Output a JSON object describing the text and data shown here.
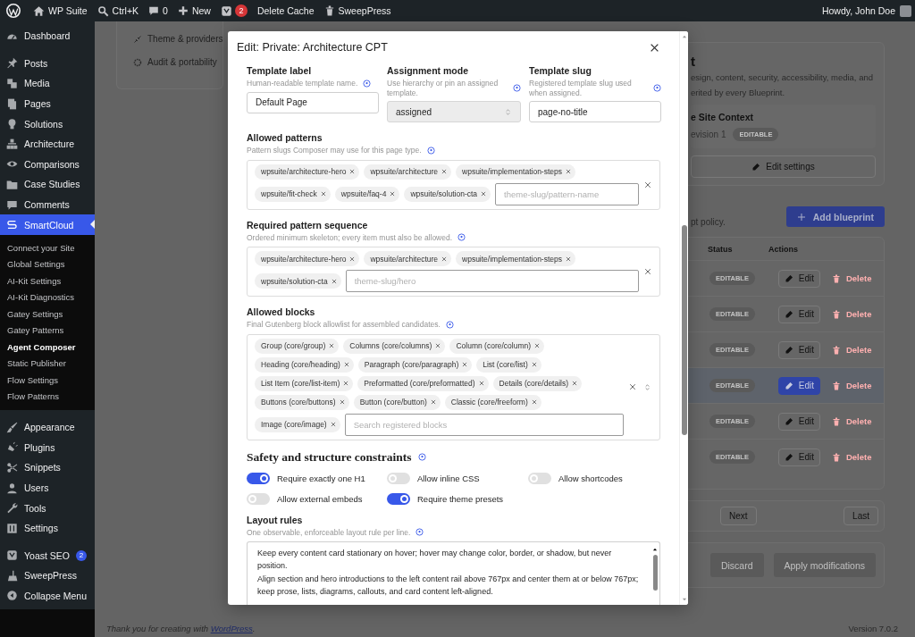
{
  "admin_bar": {
    "items": [
      {
        "kind": "logo"
      },
      {
        "kind": "site",
        "label": "WP Suite"
      },
      {
        "kind": "search",
        "label": "Ctrl+K"
      },
      {
        "kind": "comments",
        "label": "0"
      },
      {
        "kind": "new",
        "label": "New"
      },
      {
        "kind": "seo",
        "badge": "2"
      },
      {
        "kind": "text",
        "label": "Delete Cache"
      },
      {
        "kind": "sweep",
        "label": "SweepPress"
      }
    ],
    "greeting": "Howdy, John Doe"
  },
  "sidebar": {
    "groups": [
      [
        {
          "label": "Dashboard",
          "selected": false
        }
      ],
      [
        {
          "label": "Posts",
          "selected": false
        },
        {
          "label": "Media",
          "selected": false
        },
        {
          "label": "Pages",
          "selected": false
        },
        {
          "label": "Solutions",
          "selected": false
        },
        {
          "label": "Architecture",
          "selected": false
        },
        {
          "label": "Comparisons",
          "selected": false
        },
        {
          "label": "Case Studies",
          "selected": false
        },
        {
          "label": "Comments",
          "selected": false
        },
        {
          "label": "SmartCloud",
          "selected": true,
          "children": [
            {
              "label": "Connect your Site",
              "selected": false
            },
            {
              "label": "Global Settings",
              "selected": false
            },
            {
              "label": "AI-Kit Settings",
              "selected": false
            },
            {
              "label": "AI-Kit Diagnostics",
              "selected": false
            },
            {
              "label": "Gatey Settings",
              "selected": false
            },
            {
              "label": "Gatey Patterns",
              "selected": false
            },
            {
              "label": "Agent Composer",
              "selected": true
            },
            {
              "label": "Static Publisher",
              "selected": false
            },
            {
              "label": "Flow Settings",
              "selected": false
            },
            {
              "label": "Flow Patterns",
              "selected": false
            }
          ]
        }
      ],
      [
        {
          "label": "Appearance",
          "selected": false
        },
        {
          "label": "Plugins",
          "selected": false
        },
        {
          "label": "Snippets",
          "selected": false
        },
        {
          "label": "Users",
          "selected": false
        },
        {
          "label": "Tools",
          "selected": false
        },
        {
          "label": "Settings",
          "selected": false
        }
      ],
      [
        {
          "label": "Yoast SEO",
          "selected": false,
          "badge": "2"
        },
        {
          "label": "SweepPress",
          "selected": false
        },
        {
          "label": "Collapse Menu",
          "selected": false
        }
      ]
    ]
  },
  "background": {
    "side_nav": [
      {
        "label": "Theme & providers"
      },
      {
        "label": "Audit & portability"
      }
    ],
    "settings_card": {
      "title": "t",
      "description_lines": [
        "esign, content, security, accessibility, media, and",
        "erited by every Blueprint."
      ],
      "context": {
        "title": "e Site Context",
        "revision": "evision 1",
        "badge": "EDITABLE"
      },
      "button": "Edit settings"
    },
    "policy_note": "pt policy.",
    "add_button": "Add blueprint",
    "table": {
      "columns": [
        "Status",
        "Actions"
      ],
      "rows": [
        {
          "status": "EDITABLE",
          "edit": "Edit",
          "delete": "Delete",
          "selected": false
        },
        {
          "status": "EDITABLE",
          "edit": "Edit",
          "delete": "Delete",
          "selected": false
        },
        {
          "status": "EDITABLE",
          "edit": "Edit",
          "delete": "Delete",
          "selected": false
        },
        {
          "status": "EDITABLE",
          "edit": "Edit",
          "delete": "Delete",
          "selected": true
        },
        {
          "status": "EDITABLE",
          "edit": "Edit",
          "delete": "Delete",
          "selected": false
        },
        {
          "status": "EDITABLE",
          "edit": "Edit",
          "delete": "Delete",
          "selected": false
        }
      ]
    },
    "pagination": {
      "next": "Next",
      "last": "Last"
    },
    "actions": {
      "discard": "Discard",
      "apply": "Apply modifications",
      "disabled": true
    }
  },
  "modal": {
    "title": "Edit: Private: Architecture CPT",
    "fields": [
      {
        "kind": "text",
        "label": "Template label",
        "hint": "Human-readable template name.",
        "value": "Default Page"
      },
      {
        "kind": "select",
        "label": "Assignment mode",
        "hint": "Use hierarchy or pin an assigned template.",
        "value": "assigned",
        "disabled": true
      },
      {
        "kind": "text",
        "label": "Template slug",
        "hint": "Registered template slug used when assigned.",
        "value": "page-no-title"
      }
    ],
    "tag_fields": [
      {
        "label": "Allowed patterns",
        "hint": "Pattern slugs Composer may use for this page type.",
        "tags": [
          "wpsuite/architecture-hero",
          "wpsuite/architecture",
          "wpsuite/implementation-steps",
          "wpsuite/fit-check",
          "wpsuite/faq-4",
          "wpsuite/solution-cta"
        ],
        "placeholder": "theme-slug/pattern-name",
        "dropdown": false
      },
      {
        "label": "Required pattern sequence",
        "hint": "Ordered minimum skeleton; every item must also be allowed.",
        "tags": [
          "wpsuite/architecture-hero",
          "wpsuite/architecture",
          "wpsuite/implementation-steps",
          "wpsuite/solution-cta"
        ],
        "placeholder": "theme-slug/hero",
        "dropdown": false
      },
      {
        "label": "Allowed blocks",
        "hint": "Final Gutenberg block allowlist for assembled candidates.",
        "tags": [
          "Group (core/group)",
          "Columns (core/columns)",
          "Column (core/column)",
          "Heading (core/heading)",
          "Paragraph (core/paragraph)",
          "List (core/list)",
          "List Item (core/list-item)",
          "Preformatted (core/preformatted)",
          "Details (core/details)",
          "Buttons (core/buttons)",
          "Button (core/button)",
          "Classic (core/freeform)",
          "Image (core/image)"
        ],
        "placeholder": "Search registered blocks",
        "dropdown": true
      }
    ],
    "constraints": {
      "title": "Safety and structure constraints",
      "toggles": [
        {
          "label": "Require exactly one H1",
          "on": true
        },
        {
          "label": "Allow inline CSS",
          "on": false
        },
        {
          "label": "Allow shortcodes",
          "on": false
        },
        {
          "label": "Allow external embeds",
          "on": false
        },
        {
          "label": "Require theme presets",
          "on": true
        }
      ]
    },
    "layout_rules": {
      "label": "Layout rules",
      "hint": "One observable, enforceable layout rule per line.",
      "lines": [
        "Keep every content card stationary on hover; hover may change color, border, or shadow, but never position.",
        "Align section and hero introductions to the left content rail above 767px and center them at or below 767px; keep prose, lists, diagrams, callouts, and card content left-aligned."
      ]
    }
  },
  "footer": {
    "before": "Thank you for creating with",
    "link": "WordPress",
    "after": ".",
    "version": "Version 7.0.2"
  }
}
